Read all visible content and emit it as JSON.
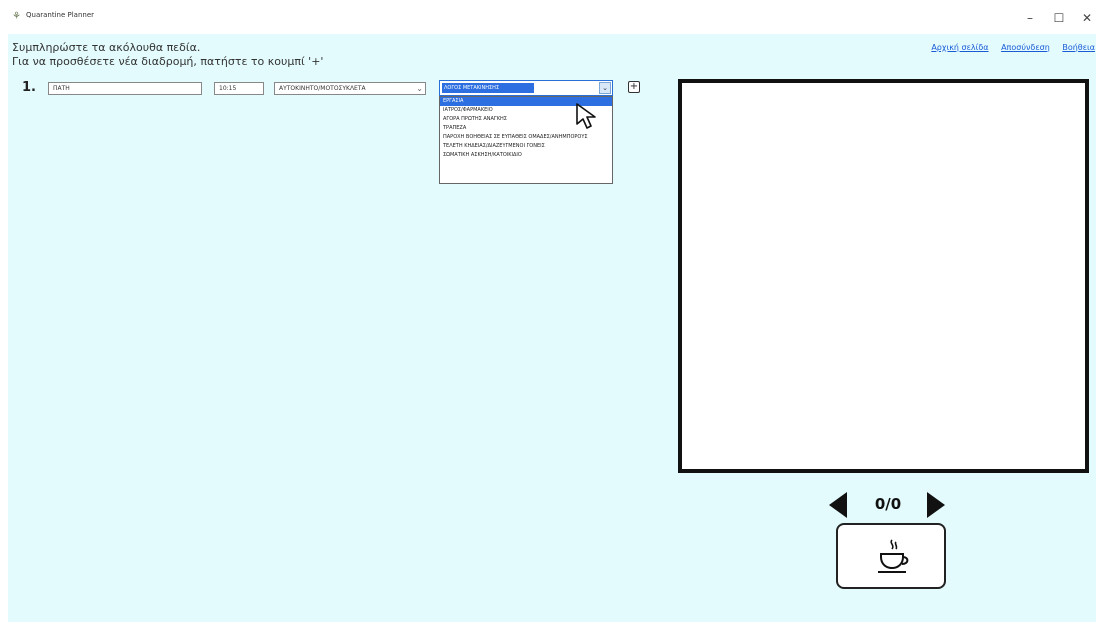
{
  "window": {
    "title": "Quarantine Planner",
    "minimize": "–",
    "maximize": "☐",
    "close": "✕"
  },
  "instructions": {
    "line1": "Συμπληρώστε τα ακόλουθα πεδία.",
    "line2": "Για να προσθέσετε νέα διαδρομή, πατήστε το κουμπί '+'"
  },
  "top_links": {
    "home": "Αρχική σελίδα",
    "logout": "Αποσύνδεση",
    "help": "Βοήθεια"
  },
  "route": {
    "number": "1.",
    "destination_value": "ΠΑΤΗ",
    "time_value": "10:15",
    "transport_value": "ΑΥΤΟΚΙΝΗΤΟ/ΜΟΤΟΣΥΚΛΕΤΑ",
    "reason_selected": "ΛΟΓΟΣ ΜΕΤΑΚΙΝΗΣΗΣ",
    "add_button": "+"
  },
  "reason_options": [
    "ΕΡΓΑΣΙΑ",
    "ΙΑΤΡΟΣ/ΦΑΡΜΑΚΕΙΟ",
    "ΑΓΟΡΑ ΠΡΩΤΗΣ ΑΝΑΓΚΗΣ",
    "ΤΡΑΠΕΖΑ",
    "ΠΑΡΟΧΗ ΒΟΗΘΕΙΑΣ ΣΕ ΕΥΠΑΘΕΙΣ ΟΜΑΔΕΣ/ΑΝΗΜΠΟΡΟΥΣ",
    "ΤΕΛΕΤΗ ΚΗΔΕΙΑΣ/ΔΙΑΖΕΥΓΜΕΝΟΙ ΓΟΝΕΙΣ",
    "ΣΩΜΑΤΙΚΗ ΑΣΚΗΣΗ/ΚΑΤΟΙΚΙΔΙΟ"
  ],
  "pager": {
    "counter": "0/0"
  },
  "icons": {
    "app": "app-logo-icon",
    "prev": "triangle-left-icon",
    "next": "triangle-right-icon",
    "coffee": "coffee-cup-icon",
    "dropdown": "chevron-down-icon",
    "cursor": "mouse-pointer-icon"
  },
  "colors": {
    "background": "#e3fbfd",
    "selection": "#2d6fe0",
    "link": "#1a5bd6"
  }
}
